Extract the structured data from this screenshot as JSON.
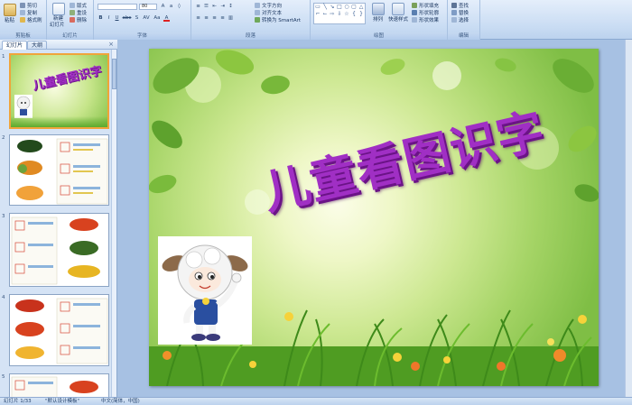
{
  "ribbon": {
    "clipboard": {
      "paste": "粘贴",
      "cut": "剪切",
      "copy": "复制",
      "format_painter": "格式刷",
      "label": "剪贴板"
    },
    "slides": {
      "new_slide": "新建",
      "new_slide_2": "幻灯片",
      "layout": "版式",
      "reset": "重设",
      "delete": "删除",
      "label": "幻灯片"
    },
    "font": {
      "size": "80",
      "label": "字体",
      "buttons": [
        "B",
        "I",
        "U",
        "abc",
        "S",
        "AV",
        "Aa",
        "A"
      ]
    },
    "paragraph": {
      "text_direction": "文字方向",
      "align_text": "对齐文本",
      "smartart": "转换为 SmartArt",
      "label": "段落"
    },
    "drawing": {
      "arrange": "排列",
      "quick_styles": "快速样式",
      "shape_fill": "形状填充",
      "shape_outline": "形状轮廓",
      "shape_effects": "形状效果",
      "label": "绘图"
    },
    "editing": {
      "find": "查找",
      "replace": "替换",
      "select": "选择",
      "label": "编辑"
    }
  },
  "panel": {
    "tab_slides": "幻灯片",
    "tab_outline": "大纲",
    "close": "×",
    "slide_numbers": [
      "1",
      "2",
      "3",
      "4",
      "5"
    ]
  },
  "slide": {
    "title": "儿童看图识字",
    "thumb_title": "儿童看图识字"
  },
  "status": {
    "slide_count": "幻灯片 1/33",
    "theme": "\"默认设计模板\"",
    "language": "中文(简体，中国)"
  },
  "colors": {
    "title_purple": "#a02fc4",
    "ribbon_blue": "#c9dcf3",
    "selection_orange": "#f0a43a"
  }
}
